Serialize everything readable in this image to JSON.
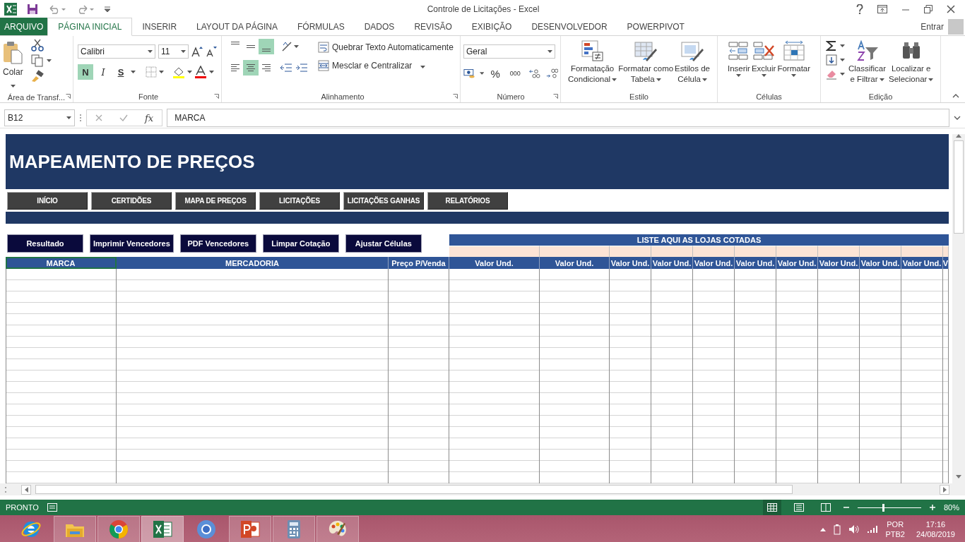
{
  "window": {
    "title": "Controle de Licitações - Excel"
  },
  "menu_tabs": [
    {
      "label": "ARQUIVO",
      "kind": "file",
      "selected": false
    },
    {
      "label": "PÁGINA INICIAL",
      "kind": "tab",
      "selected": true
    },
    {
      "label": "INSERIR",
      "kind": "tab",
      "selected": false
    },
    {
      "label": "LAYOUT DA PÁGINA",
      "kind": "tab",
      "selected": false
    },
    {
      "label": "FÓRMULAS",
      "kind": "tab",
      "selected": false
    },
    {
      "label": "DADOS",
      "kind": "tab",
      "selected": false
    },
    {
      "label": "REVISÃO",
      "kind": "tab",
      "selected": false
    },
    {
      "label": "EXIBIÇÃO",
      "kind": "tab",
      "selected": false
    },
    {
      "label": "DESENVOLVEDOR",
      "kind": "tab",
      "selected": false
    },
    {
      "label": "POWERPIVOT",
      "kind": "tab",
      "selected": false
    }
  ],
  "account": {
    "label": "Entrar"
  },
  "ribbon": {
    "clipboard": {
      "paste": "Colar",
      "label": "Área de Transf..."
    },
    "font": {
      "name": "Calibri",
      "size": "11",
      "label": "Fonte",
      "styles": [
        {
          "key": "N",
          "selected": true
        },
        {
          "key": "I",
          "selected": false
        },
        {
          "key": "S",
          "selected": false
        }
      ]
    },
    "alignment": {
      "vertical": [
        {
          "selected": false
        },
        {
          "selected": false
        },
        {
          "selected": true
        }
      ],
      "horizontal": [
        {
          "selected": false
        },
        {
          "selected": true
        },
        {
          "selected": false
        }
      ],
      "wrap": "Quebrar Texto Automaticamente",
      "merge": "Mesclar e Centralizar",
      "label": "Alinhamento"
    },
    "number": {
      "format": "Geral",
      "percent": "%",
      "thousands": "000",
      "label": "Número"
    },
    "styles": {
      "buttons": [
        {
          "kind": "conditional",
          "lines": [
            "Formatação",
            "Condicional"
          ]
        },
        {
          "kind": "table",
          "lines": [
            "Formatar como",
            "Tabela"
          ]
        },
        {
          "kind": "cellstyle",
          "lines": [
            "Estilos de",
            "Célula"
          ]
        }
      ],
      "label": "Estilo"
    },
    "cells": {
      "buttons": [
        {
          "kind": "insert",
          "lines": [
            "Inserir"
          ]
        },
        {
          "kind": "delete",
          "lines": [
            "Excluir"
          ]
        },
        {
          "kind": "format",
          "lines": [
            "Formatar"
          ]
        }
      ],
      "label": "Células"
    },
    "editing": {
      "buttons": [
        {
          "kind": "sort",
          "lines": [
            "Classificar",
            "e Filtrar"
          ]
        },
        {
          "kind": "find",
          "lines": [
            "Localizar e",
            "Selecionar"
          ]
        }
      ],
      "label": "Edição"
    }
  },
  "formula_bar": {
    "name_box": "B12",
    "function_label": "fx",
    "value": "MARCA"
  },
  "sheet": {
    "title": "MAPEAMENTO DE PREÇOS",
    "nav_buttons": [
      "INÍCIO",
      "CERTIDÕES",
      "MAPA DE PREÇOS",
      "LICITAÇÕES",
      "LICITAÇÕES GANHAS",
      "RELATÓRIOS"
    ],
    "action_buttons": [
      "Resultado",
      "Imprimir Vencedores",
      "PDF Vencedores",
      "Limpar Cotação",
      "Ajustar Células"
    ],
    "stores_header": "LISTE AQUI AS LOJAS COTADAS",
    "columns": [
      {
        "label": "MARCA",
        "selected": true
      },
      {
        "label": "MERCADORIA",
        "selected": false
      },
      {
        "label": "Preço P/Venda",
        "selected": false
      },
      {
        "label": "Valor Und.",
        "selected": false
      },
      {
        "label": "Valor Und.",
        "selected": false
      },
      {
        "label": "Valor Und.",
        "selected": false
      },
      {
        "label": "Valor Und.",
        "selected": false
      },
      {
        "label": "Valor Und.",
        "selected": false
      },
      {
        "label": "Valor Und.",
        "selected": false
      },
      {
        "label": "Valor Und.",
        "selected": false
      },
      {
        "label": "Valor Und.",
        "selected": false
      },
      {
        "label": "Valor Und.",
        "selected": false
      },
      {
        "label": "Valor Und.",
        "selected": false
      },
      {
        "label": "V",
        "selected": false
      }
    ]
  },
  "status_bar": {
    "state": "PRONTO",
    "views": [
      {
        "selected": true
      },
      {
        "selected": false
      },
      {
        "selected": false
      }
    ],
    "zoom": {
      "level": 0.39,
      "label": "80%"
    }
  },
  "taskbar": {
    "apps": [
      {
        "kind": "ie",
        "running": false,
        "selected": false
      },
      {
        "kind": "explorer",
        "running": true,
        "selected": false
      },
      {
        "kind": "chrome",
        "running": true,
        "selected": false
      },
      {
        "kind": "excel",
        "running": true,
        "selected": true
      },
      {
        "kind": "chromium",
        "running": false,
        "selected": false
      },
      {
        "kind": "powerpoint",
        "running": true,
        "selected": false
      },
      {
        "kind": "calculator",
        "running": true,
        "selected": false
      },
      {
        "kind": "paint",
        "running": true,
        "selected": false
      }
    ],
    "language": "POR",
    "layout": "PTB2",
    "time": "17:16",
    "date": "24/08/2019"
  }
}
